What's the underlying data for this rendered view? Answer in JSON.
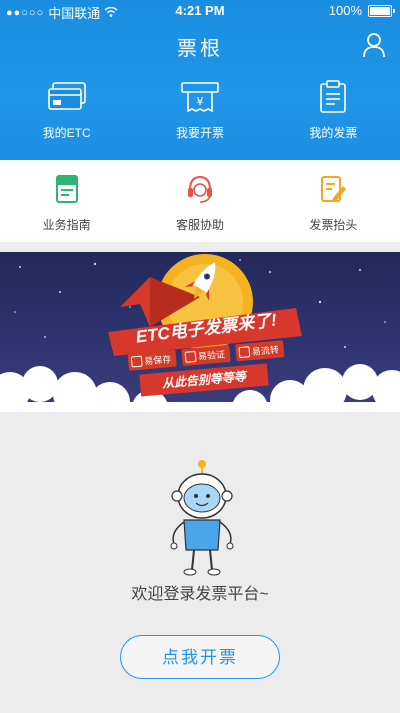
{
  "status_bar": {
    "carrier": "中国联通",
    "time": "4:21 PM",
    "battery": "100%"
  },
  "header": {
    "title": "票根"
  },
  "top_nav": [
    {
      "label": "我的ETC",
      "icon": "etc-card-icon"
    },
    {
      "label": "我要开票",
      "icon": "invoice-printer-icon"
    },
    {
      "label": "我的发票",
      "icon": "my-invoices-icon"
    }
  ],
  "services": [
    {
      "label": "业务指南",
      "icon": "guide-book-icon",
      "color": "#2bb673"
    },
    {
      "label": "客服协助",
      "icon": "customer-service-icon",
      "color": "#e8544a"
    },
    {
      "label": "发票抬头",
      "icon": "invoice-title-icon",
      "color": "#f5a623"
    }
  ],
  "banner": {
    "headline": "ETC电子发票来了!",
    "chips": [
      "易保存",
      "易验证",
      "易流转"
    ],
    "tagline": "从此告别等等等"
  },
  "main": {
    "welcome_text": "欢迎登录发票平台~",
    "cta_label": "点我开票"
  },
  "colors": {
    "primary": "#2196e8",
    "banner_red": "#d8382b"
  }
}
